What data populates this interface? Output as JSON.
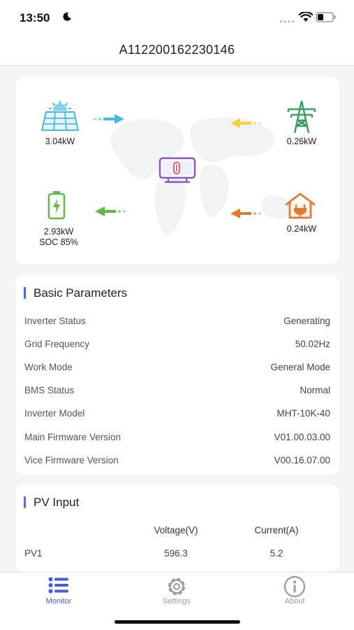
{
  "status_bar": {
    "time": "13:50"
  },
  "header": {
    "title": "A112200162230146"
  },
  "energy_flow": {
    "pv": {
      "power": "3.04kW"
    },
    "grid": {
      "power": "0.26kW"
    },
    "battery": {
      "power": "2.93kW",
      "soc": "SOC 85%"
    },
    "load": {
      "power": "0.24kW"
    },
    "colors": {
      "pv": "#4ab8e0",
      "grid": "#f2d53c",
      "battery": "#5fb84a",
      "load": "#e07a32",
      "inverter": "#8a55c8"
    }
  },
  "basic_parameters": {
    "title": "Basic Parameters",
    "rows": [
      {
        "label": "Inverter Status",
        "value": "Generating"
      },
      {
        "label": "Grid Frequency",
        "value": "50.02Hz"
      },
      {
        "label": "Work Mode",
        "value": "General Mode"
      },
      {
        "label": "BMS Status",
        "value": "Normal"
      },
      {
        "label": "Inverter Model",
        "value": "MHT-10K-40"
      },
      {
        "label": "Main Firmware Version",
        "value": "V01.00.03.00"
      },
      {
        "label": "Vice Firmware Version",
        "value": "V00.16.07.00"
      }
    ]
  },
  "pv_input": {
    "title": "PV Input",
    "columns": [
      "Voltage(V)",
      "Current(A)"
    ],
    "rows": [
      {
        "name": "PV1",
        "voltage": "596.3",
        "current": "5.2"
      }
    ]
  },
  "tab_bar": {
    "tabs": [
      {
        "label": "Monitor",
        "icon": "list-icon",
        "active": true
      },
      {
        "label": "Settings",
        "icon": "gear-icon",
        "active": false
      },
      {
        "label": "About",
        "icon": "info-icon",
        "active": false
      }
    ],
    "active_color": "#4a5bd6",
    "inactive_color": "#9a9a9a"
  }
}
